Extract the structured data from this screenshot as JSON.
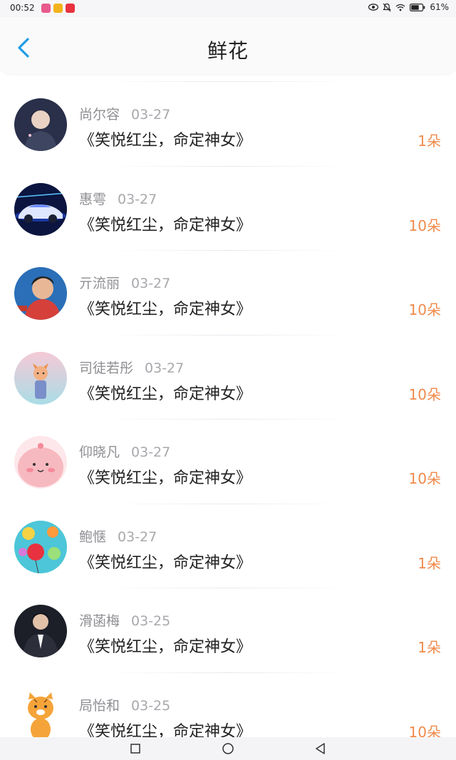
{
  "status_bar": {
    "time": "00:52",
    "battery": "61%",
    "app_icons": [
      {
        "color": "#e85a8c",
        "name": "app-icon-1"
      },
      {
        "color": "#f2b21b",
        "name": "app-icon-2"
      },
      {
        "color": "#e8323f",
        "name": "app-icon-3"
      }
    ],
    "icons": [
      "eye-icon",
      "mute-icon",
      "wifi-icon",
      "battery-icon"
    ]
  },
  "header": {
    "title": "鲜花",
    "back_icon": "chevron-left-icon",
    "accent_color": "#1f9de6"
  },
  "colors": {
    "name_text": "#8e8e93",
    "date_text": "#a8a8ad",
    "title_text": "#222222",
    "count_text": "#f08a4b"
  },
  "items": [
    {
      "name": "尚尔容",
      "date": "03-27",
      "title": "《笑悦红尘，命定神女》",
      "count": "1朵",
      "avatar": "avatar-boy-portrait"
    },
    {
      "name": "惠雩",
      "date": "03-27",
      "title": "《笑悦红尘，命定神女》",
      "count": "10朵",
      "avatar": "avatar-sports-car"
    },
    {
      "name": "亓流丽",
      "date": "03-27",
      "title": "《笑悦红尘，命定神女》",
      "count": "10朵",
      "avatar": "avatar-woman-tv"
    },
    {
      "name": "司徒若彤",
      "date": "03-27",
      "title": "《笑悦红尘，命定神女》",
      "count": "10朵",
      "avatar": "avatar-fox-cartoon"
    },
    {
      "name": "仰晓凡",
      "date": "03-27",
      "title": "《笑悦红尘，命定神女》",
      "count": "10朵",
      "avatar": "avatar-pink-blob"
    },
    {
      "name": "鲍惬",
      "date": "03-27",
      "title": "《笑悦红尘，命定神女》",
      "count": "1朵",
      "avatar": "avatar-balloons"
    },
    {
      "name": "滑菡梅",
      "date": "03-25",
      "title": "《笑悦红尘，命定神女》",
      "count": "1朵",
      "avatar": "avatar-man-suit"
    },
    {
      "name": "局怡和",
      "date": "03-25",
      "title": "《笑悦红尘，命定神女》",
      "count": "10朵",
      "avatar": "avatar-tiger-cartoon"
    }
  ],
  "nav_bar": {
    "icons": [
      "recent-apps-icon",
      "home-icon",
      "back-triangle-icon"
    ]
  }
}
